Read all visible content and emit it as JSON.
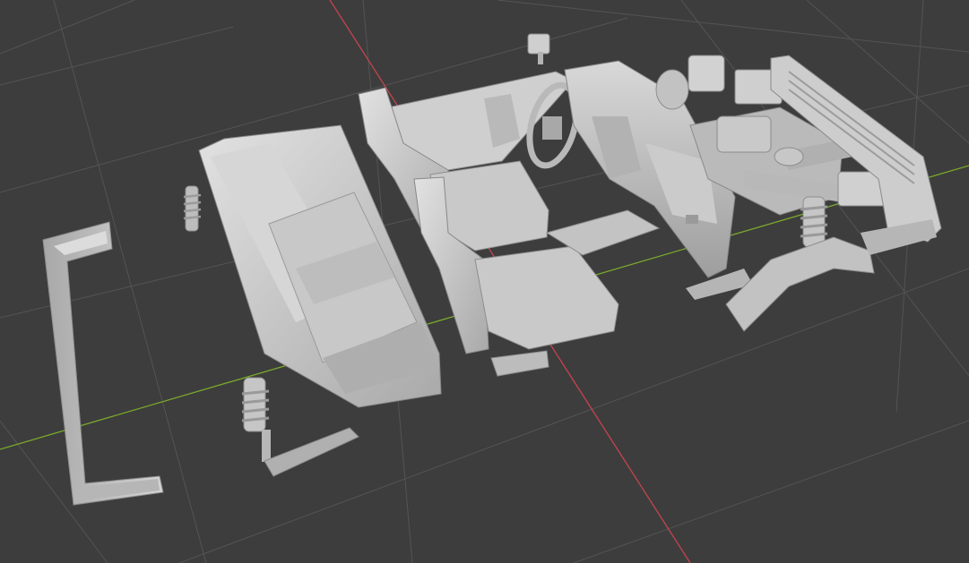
{
  "viewport": {
    "kind": "3d-viewport",
    "background_color": "#3d3d3d",
    "grid_color": "#535353",
    "x_axis_color": "#c6434f",
    "y_axis_color": "#7ba92b",
    "model_color": "#c8c8c8",
    "model_shadow_color": "#9a9a9a",
    "model_highlight_color": "#e4e4e4",
    "objects": [
      "rear-bumper",
      "rear-shock-left",
      "rear-shock-right-with-arm",
      "rear-bench-seat",
      "driver-seat",
      "passenger-seat",
      "door-panel-left",
      "side-mirror",
      "steering-wheel",
      "dashboard",
      "center-console",
      "front-fender",
      "engine",
      "front-shock",
      "front-grille",
      "air-filter"
    ]
  }
}
